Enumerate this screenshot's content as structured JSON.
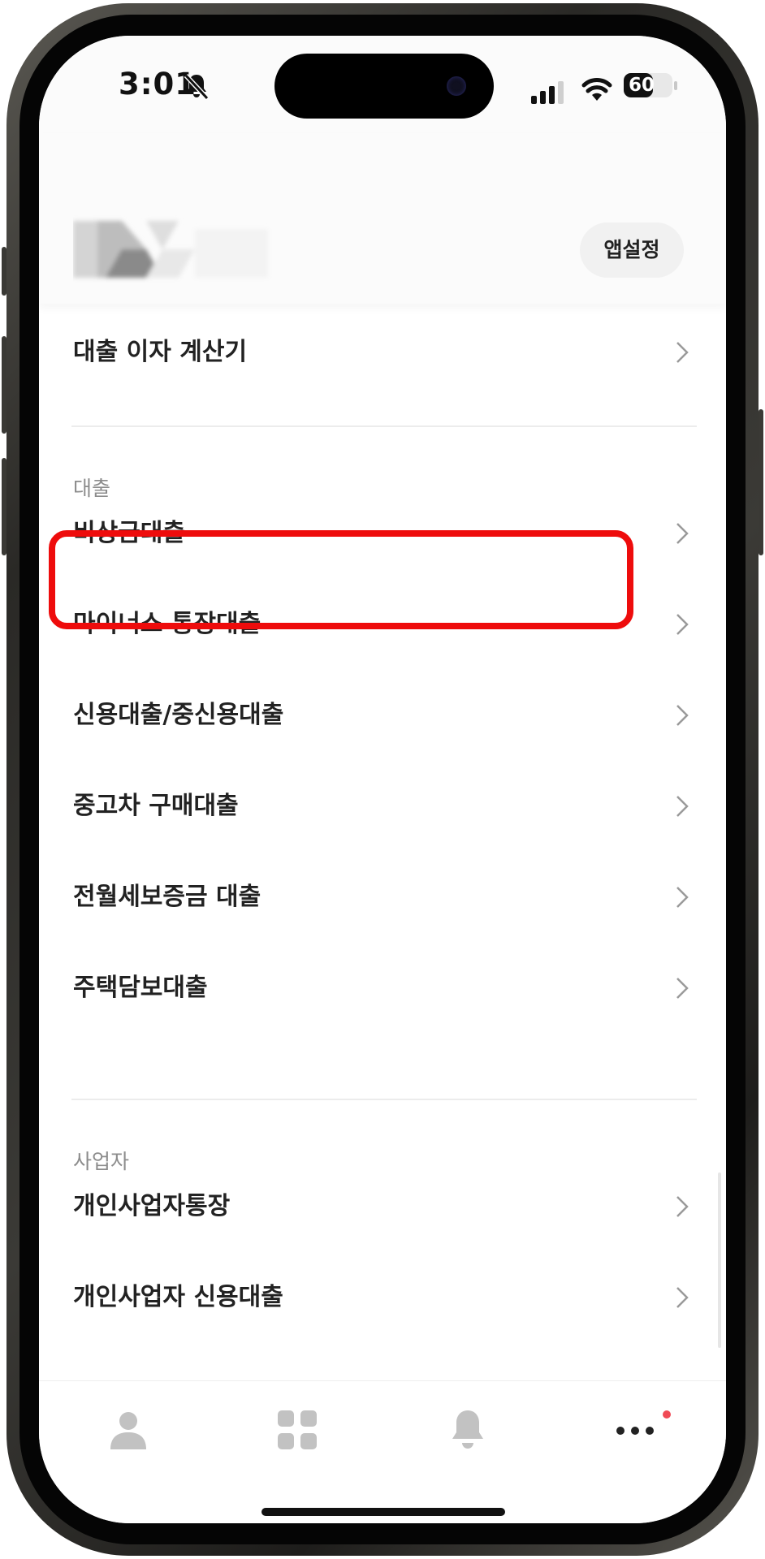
{
  "status_bar": {
    "time": "3:01",
    "battery": "60",
    "battery_level": 0.6
  },
  "header": {
    "app_settings_label": "앱설정"
  },
  "top_item": {
    "label": "대출 이자 계산기"
  },
  "sections": [
    {
      "title": "대출",
      "items": [
        {
          "label": "비상금대출"
        },
        {
          "label": "마이너스 통장대출"
        },
        {
          "label": "신용대출/중신용대출"
        },
        {
          "label": "중고차 구매대출"
        },
        {
          "label": "전월세보증금 대출"
        },
        {
          "label": "주택담보대출"
        }
      ]
    },
    {
      "title": "사업자",
      "items": [
        {
          "label": "개인사업자통장"
        },
        {
          "label": "개인사업자 신용대출"
        }
      ]
    }
  ],
  "tab_bar": {
    "tabs": [
      {
        "icon": "person-icon"
      },
      {
        "icon": "grid-icon"
      },
      {
        "icon": "bell-icon"
      },
      {
        "icon": "more-icon",
        "badge": true
      }
    ]
  },
  "colors": {
    "highlight": "#ee0c0c",
    "badge": "#f04a55",
    "text": "#222222",
    "section": "#8c8c8c"
  }
}
